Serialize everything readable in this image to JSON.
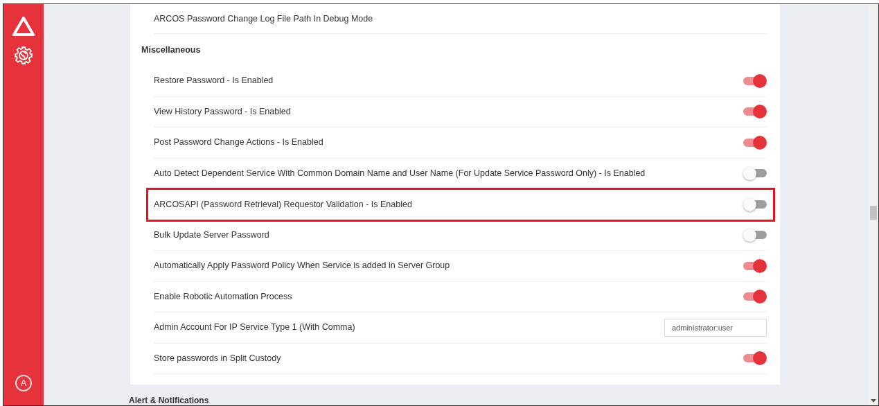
{
  "sidebar": {
    "items": [
      {
        "kind": "logo"
      },
      {
        "kind": "settings"
      }
    ],
    "avatar": "A"
  },
  "top_row": {
    "label": "ARCOS Password Change Log File Path In Debug Mode"
  },
  "section": {
    "title": "Miscellaneous",
    "rows": [
      {
        "kind": "toggle",
        "label": "Restore Password - Is Enabled",
        "on": true,
        "highlighted": false
      },
      {
        "kind": "toggle",
        "label": "View History Password - Is Enabled",
        "on": true,
        "highlighted": false
      },
      {
        "kind": "toggle",
        "label": "Post Password Change Actions - Is Enabled",
        "on": true,
        "highlighted": false
      },
      {
        "kind": "toggle",
        "label": "Auto Detect Dependent Service With Common Domain Name and User Name (For Update Service Password Only) - Is Enabled",
        "on": false,
        "highlighted": false
      },
      {
        "kind": "toggle",
        "label": "ARCOSAPI (Password Retrieval) Requestor Validation - Is Enabled",
        "on": false,
        "highlighted": true
      },
      {
        "kind": "toggle",
        "label": "Bulk Update Server Password",
        "on": false,
        "highlighted": false
      },
      {
        "kind": "toggle",
        "label": "Automatically Apply Password Policy When Service is added in Server Group",
        "on": true,
        "highlighted": false
      },
      {
        "kind": "toggle",
        "label": "Enable Robotic Automation Process",
        "on": true,
        "highlighted": false
      },
      {
        "kind": "text",
        "label": "Admin Account For IP Service Type 1 (With Comma)",
        "value": "administrator:user",
        "highlighted": false
      },
      {
        "kind": "toggle",
        "label": "Store passwords in Split Custody",
        "on": true,
        "highlighted": false
      }
    ]
  },
  "next_section": {
    "title": "Alert & Notifications"
  }
}
